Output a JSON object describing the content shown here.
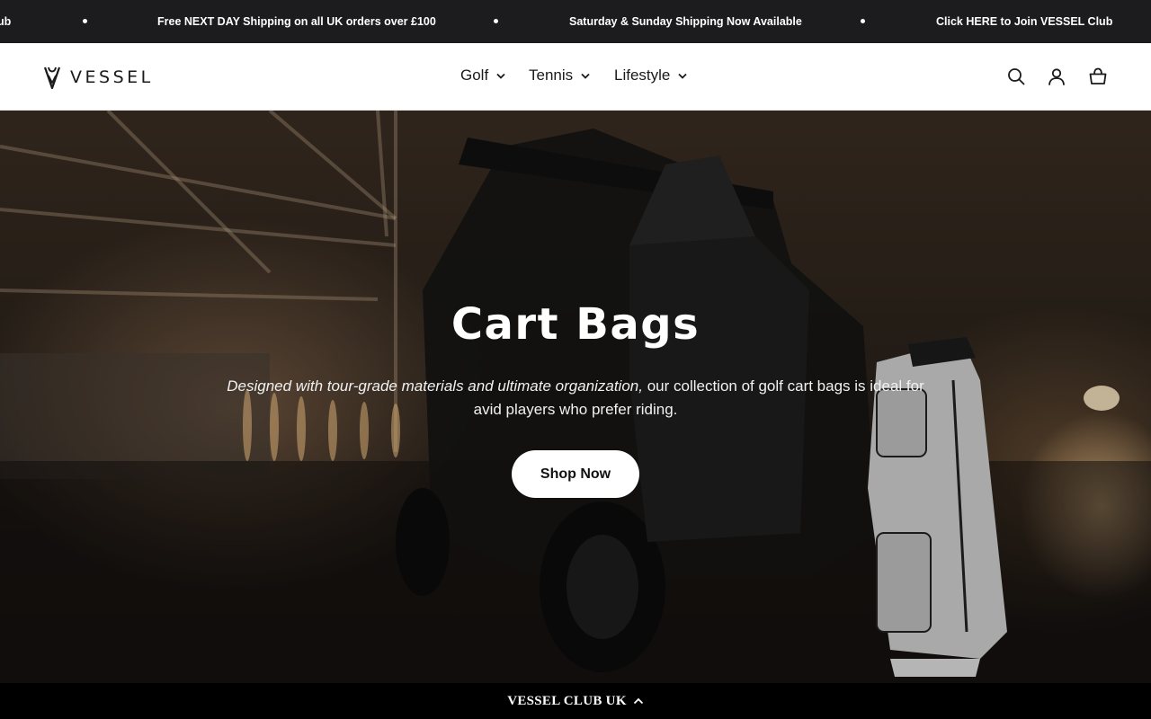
{
  "announcement": {
    "items": [
      "ub",
      "Free NEXT DAY Shipping on all UK orders over £100",
      "Saturday & Sunday Shipping Now Available",
      "Click HERE to Join VESSEL Club"
    ]
  },
  "header": {
    "logo_text": "VESSEL",
    "nav": [
      {
        "label": "Golf"
      },
      {
        "label": "Tennis"
      },
      {
        "label": "Lifestyle"
      }
    ],
    "icons": [
      "search-icon",
      "account-icon",
      "cart-icon"
    ]
  },
  "hero": {
    "title": "Cart Bags",
    "subtitle_italic": "Designed with tour-grade materials and ultimate organization,",
    "subtitle_rest": " our collection of golf cart bags is ideal for avid players who prefer riding.",
    "button_label": "Shop Now"
  },
  "club_bar": {
    "label": "VESSEL CLUB UK"
  },
  "colors": {
    "announcement_bg": "#1c1c1e",
    "header_bg": "#ffffff",
    "club_bar_bg": "#000000",
    "button_bg": "#ffffff"
  }
}
